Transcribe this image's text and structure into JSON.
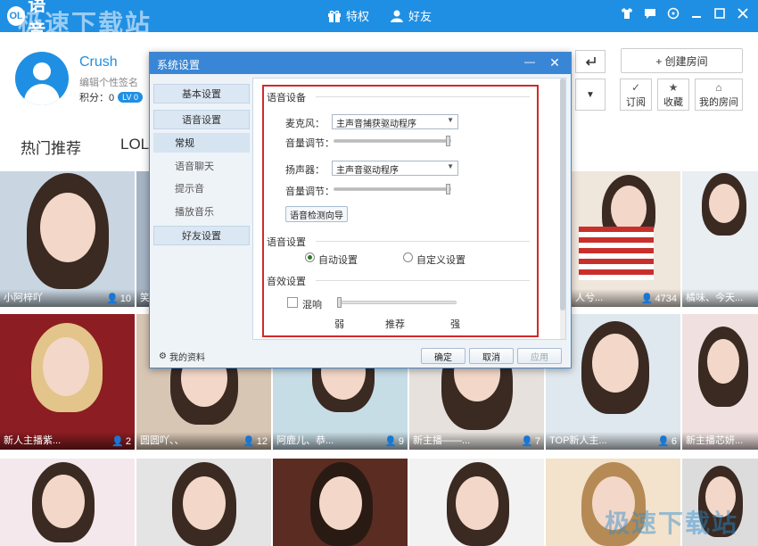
{
  "app": {
    "logo_badge": "OL",
    "logo_text": "语音",
    "watermark": "极速下载站"
  },
  "topnav": {
    "privilege_label": "特权",
    "friends_label": "好友"
  },
  "window_controls": [
    "shirt-icon",
    "message-icon",
    "settings-circle-icon",
    "minimize-icon",
    "maximize-icon",
    "close-icon"
  ],
  "profile": {
    "name": "Crush",
    "signature": "编辑个性签名",
    "points_label": "积分：0",
    "level": "LV 0"
  },
  "header_buttons": {
    "create_room": "+ 创建房间",
    "subscribe": "订阅",
    "favorite": "收藏",
    "my_room": "我的房间"
  },
  "tabs": [
    "热门推荐",
    "LOL"
  ],
  "rooms": [
    {
      "name": "小阿梓吖",
      "count": "10"
    },
    {
      "name": "笑",
      "count": ""
    },
    {
      "name": "",
      "count": ""
    },
    {
      "name": "",
      "count": ""
    },
    {
      "name": "人兮...",
      "count": "4734"
    },
    {
      "name": "橘味、今天...",
      "count": ""
    },
    {
      "name": "新人主播紫...",
      "count": "2"
    },
    {
      "name": "圆圆吖、、",
      "count": "12"
    },
    {
      "name": "阿鹿儿、恭...",
      "count": "9"
    },
    {
      "name": "新主播——...",
      "count": "7"
    },
    {
      "name": "TOP新人主...",
      "count": "6"
    },
    {
      "name": "新主播芯妍...",
      "count": ""
    }
  ],
  "dialog": {
    "title": "系统设置",
    "nav": {
      "basic": "基本设置",
      "voice": "语音设置",
      "voice_sub": [
        "常规",
        "语音聊天",
        "提示音",
        "播放音乐"
      ],
      "friends": "好友设置"
    },
    "voice_device": {
      "section": "语音设备",
      "mic_label": "麦克风：",
      "mic_value": "主声音捕获驱动程序",
      "mic_volume_label": "音量调节：",
      "mic_volume": 1.0,
      "speaker_label": "扬声器：",
      "speaker_value": "主声音驱动程序",
      "speaker_volume_label": "音量调节：",
      "speaker_volume": 1.0,
      "wizard_button": "语音检测向导"
    },
    "voice_settings": {
      "section": "语音设置",
      "auto_label": "自动设置",
      "custom_label": "自定义设置",
      "selected": "auto"
    },
    "sound_effects": {
      "section": "音效设置",
      "reverb_label": "混响",
      "reverb_checked": false,
      "marks": [
        "弱",
        "推荐",
        "强"
      ]
    },
    "footer": {
      "my_profile": "我的资料",
      "ok": "确定",
      "cancel": "取消",
      "apply": "应用"
    }
  }
}
